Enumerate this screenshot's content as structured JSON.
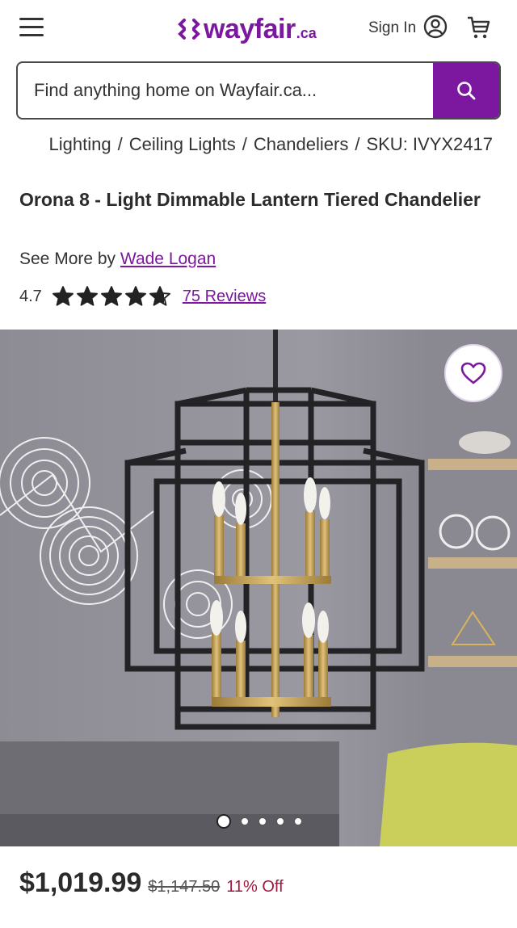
{
  "header": {
    "logo_text": "wayfair",
    "logo_tld": ".ca",
    "signin_label": "Sign In",
    "brand_color": "#7b189f",
    "icons": [
      "menu-icon",
      "user-icon",
      "cart-icon"
    ]
  },
  "search": {
    "placeholder": "Find anything home on Wayfair.ca...",
    "icon": "search-icon"
  },
  "breadcrumb": {
    "items": [
      "Lighting",
      "Ceiling Lights",
      "Chandeliers",
      "SKU: IVYX2417"
    ]
  },
  "product": {
    "title": "Orona 8 - Light Dimmable Lantern Tiered Chandelier",
    "see_more_prefix": "See More by",
    "brand": "Wade Logan",
    "rating": "4.7",
    "rating_value": 4.7,
    "rating_max": 5,
    "reviews_label": "75 Reviews",
    "image_count": 5,
    "active_image": 1
  },
  "pricing": {
    "price": "$1,019.99",
    "original_price": "$1,147.50",
    "discount": "11% Off",
    "discount_color": "#a01840"
  }
}
